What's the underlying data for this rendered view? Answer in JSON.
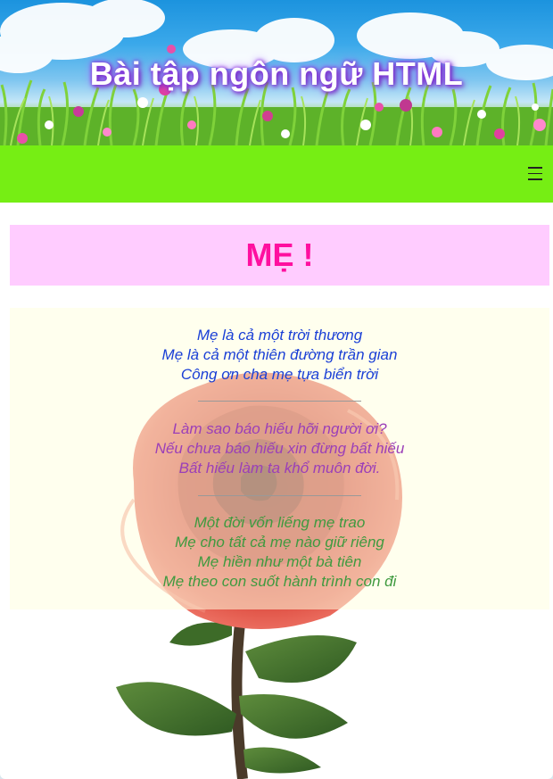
{
  "header": {
    "title": "Bài tập ngôn ngữ HTML"
  },
  "navbar": {
    "menu_icon": "hamburger-menu-icon",
    "background_color": "#76ee14"
  },
  "main": {
    "title": "MẸ !",
    "title_color": "#ff0f9f",
    "title_background": "#ffccff"
  },
  "poem": {
    "stanzas": [
      {
        "color": "#1a3fd6",
        "lines": [
          "Mẹ là cả một trời thương",
          "Mẹ là cả một thiên đường trần gian",
          "Công ơn cha mẹ tựa biển trời"
        ]
      },
      {
        "color": "#9b3fb8",
        "lines": [
          "Làm sao báo hiếu hỡi người ơi?",
          "Nếu chưa báo hiếu xin đừng bất hiếu",
          "Bất hiếu làm ta khổ muôn đời."
        ]
      },
      {
        "color": "#3f9a3f",
        "lines": [
          "Một đời vốn liếng mẹ trao",
          "Mẹ cho tất cả mẹ nào giữ riêng",
          "Mẹ hiền như một bà tiên",
          "Mẹ theo con suốt hành trình con đi"
        ]
      }
    ]
  }
}
